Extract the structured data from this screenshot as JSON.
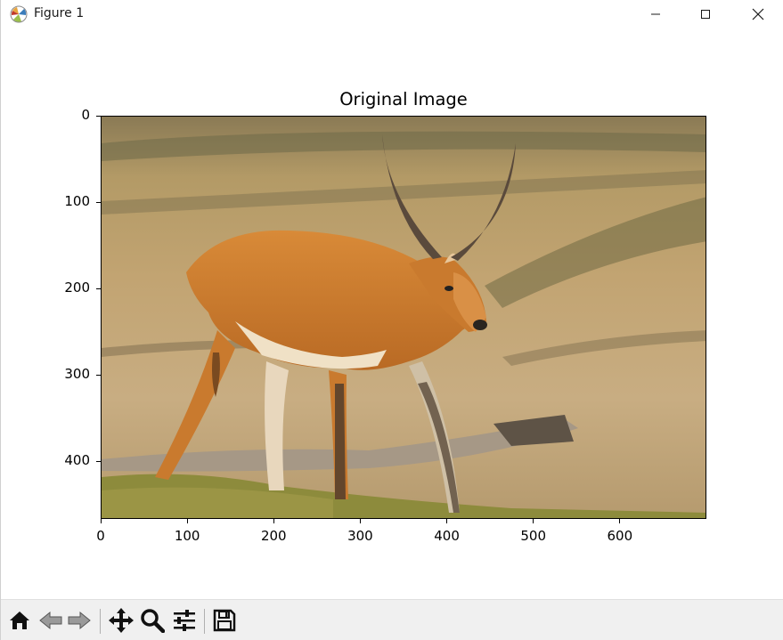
{
  "window": {
    "title": "Figure 1",
    "controls": {
      "minimize": "minimize-icon",
      "maximize": "maximize-icon",
      "close": "close-icon"
    }
  },
  "figure": {
    "title": "Original Image",
    "image_description_icon": "antelope-photo",
    "x_ticks": [
      "0",
      "100",
      "200",
      "300",
      "400",
      "500",
      "600"
    ],
    "y_ticks": [
      "0",
      "100",
      "200",
      "300",
      "400"
    ],
    "xlim": [
      0,
      700
    ],
    "ylim": [
      467,
      0
    ]
  },
  "toolbar": {
    "buttons": [
      {
        "name": "home-button",
        "icon": "home-icon"
      },
      {
        "name": "back-button",
        "icon": "back-arrow-icon"
      },
      {
        "name": "forward-button",
        "icon": "forward-arrow-icon"
      },
      {
        "name": "pan-button",
        "icon": "move-icon"
      },
      {
        "name": "zoom-button",
        "icon": "magnifier-icon"
      },
      {
        "name": "configure-subplots-button",
        "icon": "sliders-icon"
      },
      {
        "name": "save-button",
        "icon": "floppy-disk-icon"
      }
    ]
  },
  "colors": {
    "toolbar_bg": "#f0f0f0",
    "window_bg": "#ffffff",
    "ground": "#c9a877",
    "grass": "#8a8a3a",
    "antelope": "#c97a2e"
  }
}
